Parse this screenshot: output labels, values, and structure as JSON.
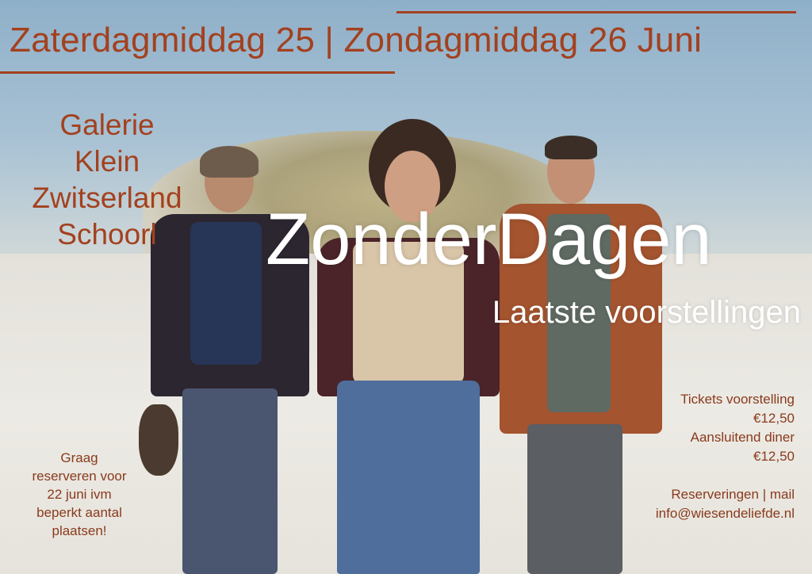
{
  "header": {
    "date_line": "Zaterdagmiddag 25 | Zondagmiddag 26 Juni"
  },
  "venue": {
    "lines": [
      "Galerie",
      "Klein",
      "Zwitserland",
      "Schoorl"
    ]
  },
  "title": {
    "main": "ZonderDagen",
    "subtitle": "Laatste voorstellingen"
  },
  "info": {
    "tickets_label": "Tickets voorstelling",
    "tickets_price": "€12,50",
    "dinner_label": "Aansluitend diner",
    "dinner_price": "€12,50",
    "reservations_label": "Reserveringen | mail",
    "email": "info@wiesendeliefde.nl"
  },
  "note": {
    "lines": [
      "Graag",
      "reserveren voor",
      "22 juni ivm",
      "beperkt aantal",
      "plaatsen!"
    ]
  },
  "colors": {
    "accent": "#a3411f",
    "title_text": "#ffffff"
  }
}
